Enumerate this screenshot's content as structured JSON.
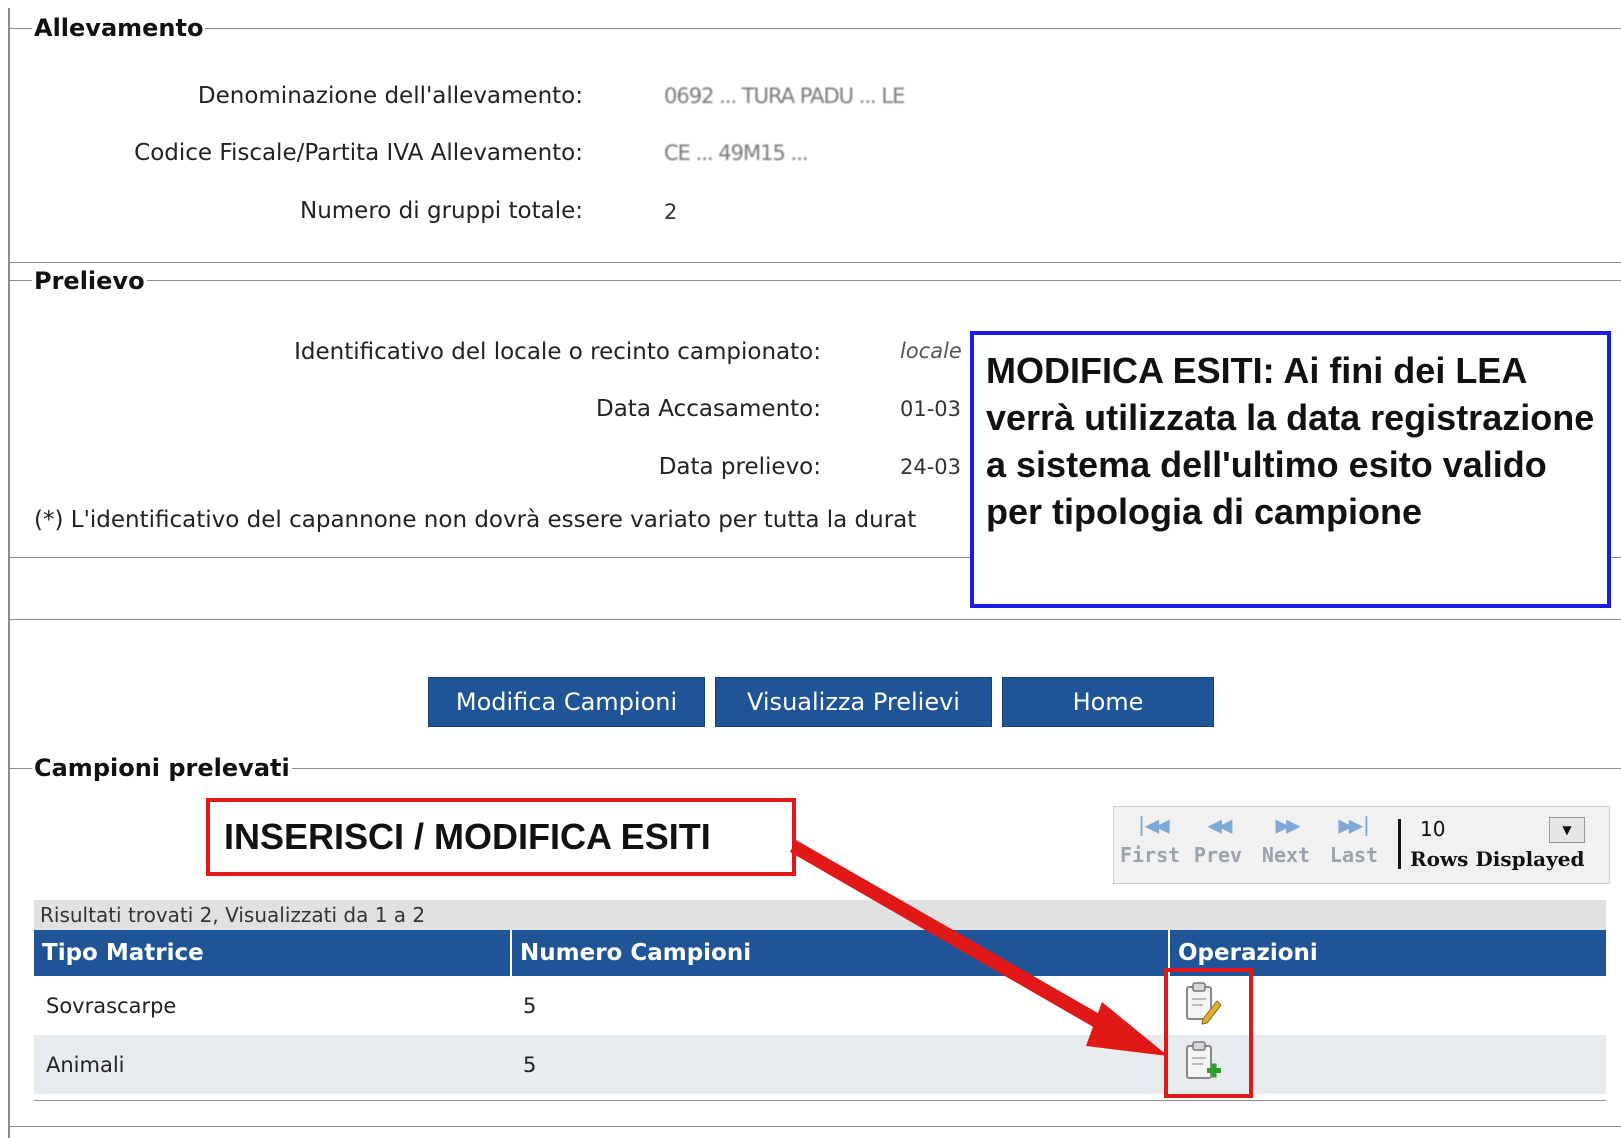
{
  "allevamento": {
    "legend": "Allevamento",
    "denominazione_label": "Denominazione dell'allevamento:",
    "denominazione_value": "0692 ... TURA PADU ... LE",
    "codice_label": "Codice Fiscale/Partita IVA Allevamento:",
    "codice_value": "CE ... 49M15 ...",
    "gruppi_label": "Numero di gruppi totale:",
    "gruppi_value": "2"
  },
  "prelievo": {
    "legend": "Prelievo",
    "identificativo_label": "Identificativo del locale o recinto campionato:",
    "identificativo_value": "locale",
    "data_accasamento_label": "Data Accasamento:",
    "data_accasamento_value": "01-03",
    "data_prelievo_label": "Data prelievo:",
    "data_prelievo_value": "24-03",
    "note": "(*) L'identificativo del capannone non dovrà essere variato per tutta la durat"
  },
  "buttons": {
    "modifica_campioni": "Modifica Campioni",
    "visualizza_prelievi": "Visualizza Prelievi",
    "home": "Home"
  },
  "campioni": {
    "legend": "Campioni prelevati",
    "pager": {
      "first": "First",
      "prev": "Prev",
      "next": "Next",
      "last": "Last",
      "rows_value": "10",
      "rows_label": "Rows Displayed"
    },
    "results_text": "Risultati trovati 2, Visualizzati da 1 a 2",
    "columns": [
      "Tipo Matrice",
      "Numero Campioni",
      "Operazioni"
    ],
    "rows": [
      {
        "tipo": "Sovrascarpe",
        "numero": "5",
        "operation_icon": "clipboard-edit-icon"
      },
      {
        "tipo": "Animali",
        "numero": "5",
        "operation_icon": "clipboard-add-icon"
      }
    ]
  },
  "annotations": {
    "blue_callout": "MODIFICA ESITI: Ai fini dei LEA verrà utilizzata la data registrazione a sistema dell'ultimo esito valido per tipologia di campione",
    "red_callout": "INSERISCI / MODIFICA ESITI",
    "colors": {
      "callout_blue": "#1c1ce0",
      "callout_red": "#e01818",
      "header_blue": "#1f5597"
    }
  }
}
